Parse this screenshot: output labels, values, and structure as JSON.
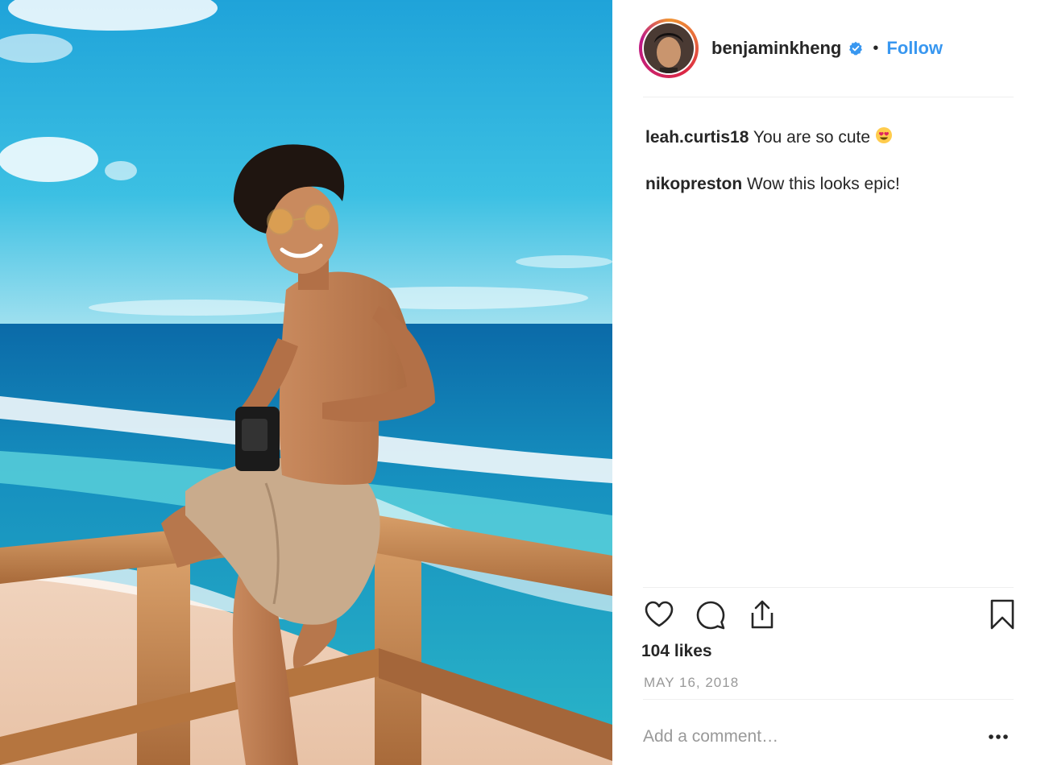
{
  "post": {
    "username": "benjaminkheng",
    "verified_icon": "verified-badge-icon",
    "separator": "•",
    "follow_label": "Follow",
    "comments": [
      {
        "author": "leah.curtis18",
        "text": "You are so cute",
        "emoji": "heart-eyes-emoji"
      },
      {
        "author": "nikopreston",
        "text": "Wow this looks epic!"
      }
    ],
    "likes": "104 likes",
    "date": "MAY 16, 2018",
    "comment_placeholder": "Add a comment…",
    "icons": {
      "like": "heart-icon",
      "comment": "comment-icon",
      "share": "share-icon",
      "save": "bookmark-icon",
      "more": "more-options-icon"
    }
  },
  "colors": {
    "link_blue": "#3897f0",
    "text": "#262626",
    "muted": "#999999",
    "divider": "#efefef"
  }
}
